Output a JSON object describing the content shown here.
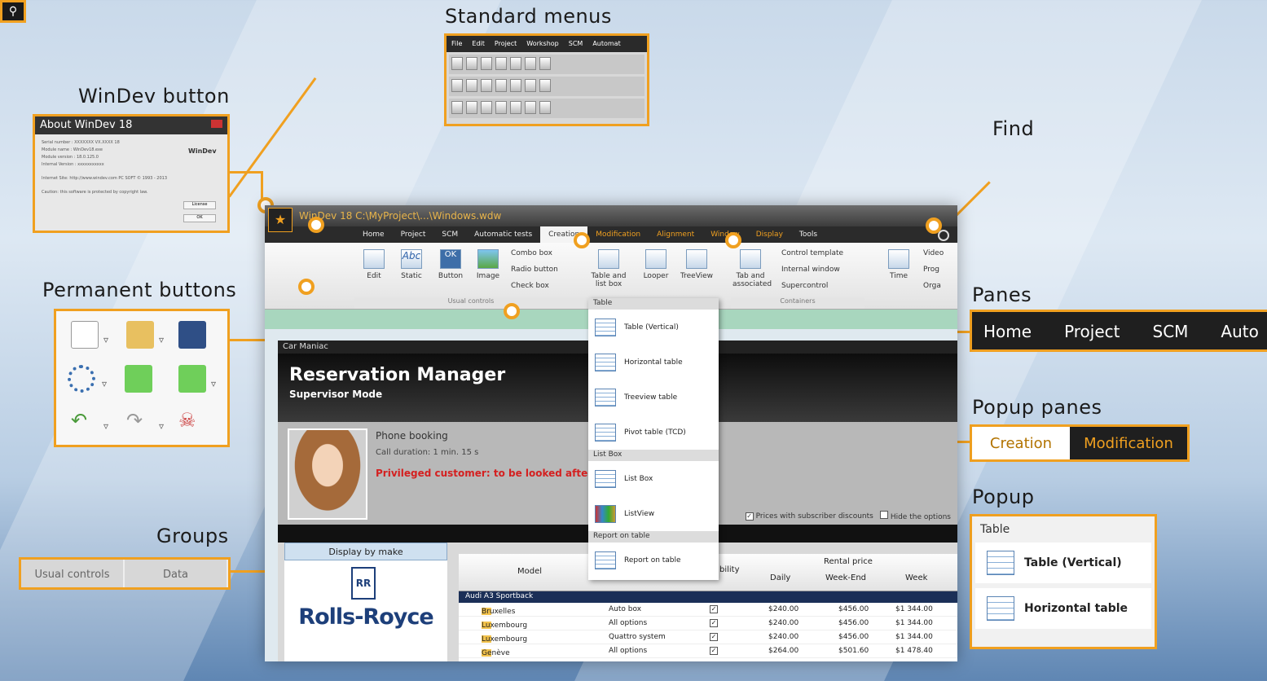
{
  "callouts": {
    "windev_button": "WinDev button",
    "standard_menus": "Standard menus",
    "find": "Find",
    "permanent_buttons": "Permanent buttons",
    "groups": "Groups",
    "panes": "Panes",
    "popup_panes": "Popup panes",
    "popup": "Popup"
  },
  "accent_color": "#f0a020",
  "about": {
    "title": "About WinDev 18",
    "lines": [
      "Serial number   :  XXXXXXX  VX.XXXX  18",
      "Module name     :  WinDev18.exe",
      "Module version  :  18.0.125.0",
      "Internal Version :  xxxxxxxxxxx",
      "Internet Site: http://www.windev.com      PC SOFT © 1993 - 2013",
      "Caution: this software is protected by copyright law."
    ],
    "logo": "WinDev",
    "license_button": "License",
    "ok_button": "OK"
  },
  "standard_menus": {
    "items": [
      "File",
      "Edit",
      "Project",
      "Workshop",
      "SCM",
      "Automat"
    ]
  },
  "find_icon": "search-icon",
  "groups_box": [
    "Usual controls",
    "Data"
  ],
  "panes_box": [
    "Home",
    "Project",
    "SCM",
    "Auto"
  ],
  "popup_panes_box": {
    "creation": "Creation",
    "modification": "Modification"
  },
  "popup_box": {
    "header": "Table",
    "items": [
      "Table (Vertical)",
      "Horizontal table"
    ]
  },
  "window": {
    "title": "WinDev 18  C:\\MyProject\\...\\Windows.wdw",
    "tabs": [
      "Home",
      "Project",
      "SCM",
      "Automatic tests",
      "Creation",
      "Modification",
      "Alignment",
      "Window",
      "Display",
      "Tools"
    ],
    "ribbon": {
      "edit": "Edit",
      "static": "Static",
      "static_icon_text": "Abc",
      "button": "Button",
      "button_icon_text": "OK",
      "image": "Image",
      "combo": "Combo box",
      "radio": "Radio button",
      "check": "Check box",
      "table": "Table and list box",
      "looper": "Looper",
      "treeview": "TreeView",
      "tab": "Tab and associated",
      "control_template": "Control template",
      "internal_window": "Internal window",
      "supercontrol": "Supercontrol",
      "time": "Time",
      "video": "Video",
      "prog": "Prog",
      "orga": "Orga",
      "group_usual": "Usual controls",
      "group_containers": "Containers"
    },
    "dropdown": {
      "sec_table": "Table",
      "table_items": [
        "Table (Vertical)",
        "Horizontal table",
        "Treeview table",
        "Pivot table (TCD)"
      ],
      "sec_list": "List Box",
      "list_items": [
        "List Box",
        "ListView"
      ],
      "sec_report": "Report on table",
      "report_items": [
        "Report on table"
      ]
    },
    "app": {
      "company": "Car Maniac",
      "title": "Reservation Manager",
      "subtitle": "Supervisor Mode",
      "call": "Phone booking",
      "duration": "Call duration: 1 min. 15 s",
      "privileged": "Privileged customer: to be looked after",
      "opt_prices": "Prices with subscriber discounts",
      "opt_hide": "Hide the options",
      "display_by_make": "Display by make",
      "brand": "Rolls-Royce",
      "brand_badge": "RR",
      "grid": {
        "h_model": "Model",
        "h_avail": "bility",
        "h_rental": "Rental price",
        "h_daily": "Daily",
        "h_weekend": "Week-End",
        "h_week": "Week",
        "group": "Audi A3 Sportback",
        "rows": [
          {
            "city": "Bruxelles",
            "opt": "Auto box",
            "daily": "$240.00",
            "weekend": "$456.00",
            "week": "$1 344.00"
          },
          {
            "city": "Luxembourg",
            "opt": "All options",
            "daily": "$240.00",
            "weekend": "$456.00",
            "week": "$1 344.00"
          },
          {
            "city": "Luxembourg",
            "opt": "Quattro system",
            "daily": "$240.00",
            "weekend": "$456.00",
            "week": "$1 344.00"
          },
          {
            "city": "Genève",
            "opt": "All options",
            "daily": "$264.00",
            "weekend": "$501.60",
            "week": "$1 478.40"
          }
        ]
      }
    }
  }
}
